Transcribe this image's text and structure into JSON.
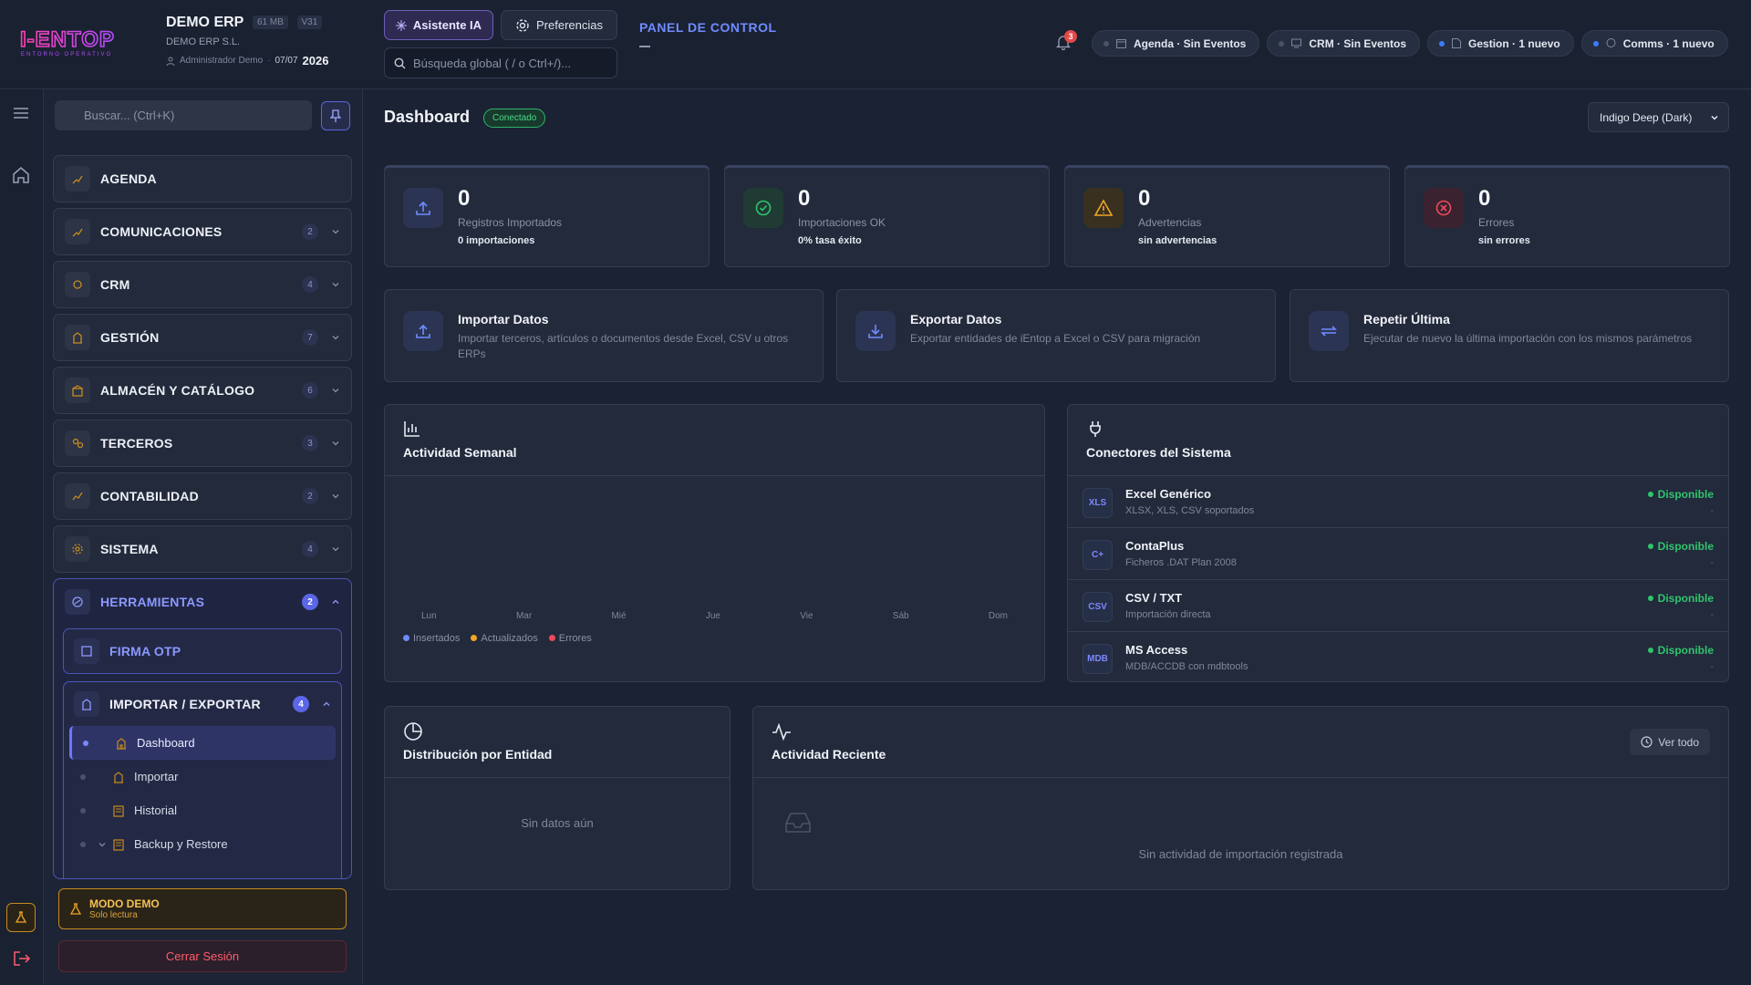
{
  "header": {
    "logo_text": "I-ENTOP",
    "logo_tagline": "ENTORNO OPERATIVO",
    "company_name": "DEMO ERP",
    "mem_badge": "61 MB",
    "version_badge": "V31",
    "company_legal": "DEMO ERP S.L.",
    "user": "Administrador Demo",
    "date": "07/07",
    "year": "2026",
    "ai_button": "Asistente IA",
    "prefs_button": "Preferencias",
    "search_placeholder": "Búsqueda global ( / o Ctrl+/)...",
    "panel_title": "PANEL DE CONTROL",
    "notif_count": "3",
    "chips": [
      {
        "label": "Agenda · Sin Eventos",
        "icon": "calendar-icon",
        "dot": "gray"
      },
      {
        "label": "CRM · Sin Eventos",
        "icon": "screen-icon",
        "dot": "gray"
      },
      {
        "label": "Gestion · 1 nuevo",
        "icon": "doc-icon",
        "dot": "blue"
      },
      {
        "label": "Comms · 1 nuevo",
        "icon": "chat-icon",
        "dot": "blue"
      }
    ]
  },
  "sidebar": {
    "search_placeholder": "Buscar... (Ctrl+K)",
    "items": [
      {
        "label": "AGENDA",
        "badge": null
      },
      {
        "label": "COMUNICACIONES",
        "badge": "2"
      },
      {
        "label": "CRM",
        "badge": "4"
      },
      {
        "label": "GESTIÓN",
        "badge": "7"
      },
      {
        "label": "ALMACÉN Y CATÁLOGO",
        "badge": "6"
      },
      {
        "label": "TERCEROS",
        "badge": "3"
      },
      {
        "label": "CONTABILIDAD",
        "badge": "2"
      },
      {
        "label": "SISTEMA",
        "badge": "4"
      }
    ],
    "tools": {
      "label": "HERRAMIENTAS",
      "badge": "2",
      "firma": "FIRMA OTP",
      "import_group": "IMPORTAR / EXPORTAR",
      "import_badge": "4",
      "leaves": [
        "Dashboard",
        "Importar",
        "Historial",
        "Backup y Restore"
      ]
    },
    "demo_title": "MODO DEMO",
    "demo_sub": "Solo lectura",
    "logout": "Cerrar Sesión"
  },
  "main": {
    "title": "Dashboard",
    "status": "Conectado",
    "theme": "Indigo Deep (Dark)",
    "stats": [
      {
        "value": "0",
        "label": "Registros Importados",
        "sub": "0 importaciones",
        "color": "#6f8cff"
      },
      {
        "value": "0",
        "label": "Importaciones OK",
        "sub": "0% tasa éxito",
        "color": "#2fc46e"
      },
      {
        "value": "0",
        "label": "Advertencias",
        "sub": "sin advertencias",
        "color": "#f0a524"
      },
      {
        "value": "0",
        "label": "Errores",
        "sub": "sin errores",
        "color": "#ef4a5a"
      }
    ],
    "actions": [
      {
        "title": "Importar Datos",
        "desc": "Importar terceros, artículos o documentos desde Excel, CSV u otros ERPs"
      },
      {
        "title": "Exportar Datos",
        "desc": "Exportar entidades de iEntop a Excel o CSV para migración"
      },
      {
        "title": "Repetir Última",
        "desc": "Ejecutar de nuevo la última importación con los mismos parámetros"
      }
    ],
    "weekly": {
      "title": "Actividad Semanal",
      "days": [
        "Lun",
        "Mar",
        "Mié",
        "Jue",
        "Vie",
        "Sáb",
        "Dom"
      ],
      "legend": [
        {
          "label": "Insertados",
          "color": "#6f8cff"
        },
        {
          "label": "Actualizados",
          "color": "#f0a524"
        },
        {
          "label": "Errores",
          "color": "#ef4a5a"
        }
      ]
    },
    "connectors": {
      "title": "Conectores del Sistema",
      "rows": [
        {
          "code": "XLS",
          "name": "Excel Genérico",
          "desc": "XLSX, XLS, CSV soportados",
          "status": "Disponible",
          "extra": "-"
        },
        {
          "code": "C+",
          "name": "ContaPlus",
          "desc": "Ficheros .DAT Plan 2008",
          "status": "Disponible",
          "extra": "-"
        },
        {
          "code": "CSV",
          "name": "CSV / TXT",
          "desc": "Importación directa",
          "status": "Disponible",
          "extra": "-"
        },
        {
          "code": "MDB",
          "name": "MS Access",
          "desc": "MDB/ACCDB con mdbtools",
          "status": "Disponible",
          "extra": "-"
        }
      ]
    },
    "distribution": {
      "title": "Distribución por Entidad",
      "empty": "Sin datos aún"
    },
    "recent": {
      "title": "Actividad Reciente",
      "see_all": "Ver todo",
      "empty": "Sin actividad de importación registrada"
    }
  }
}
